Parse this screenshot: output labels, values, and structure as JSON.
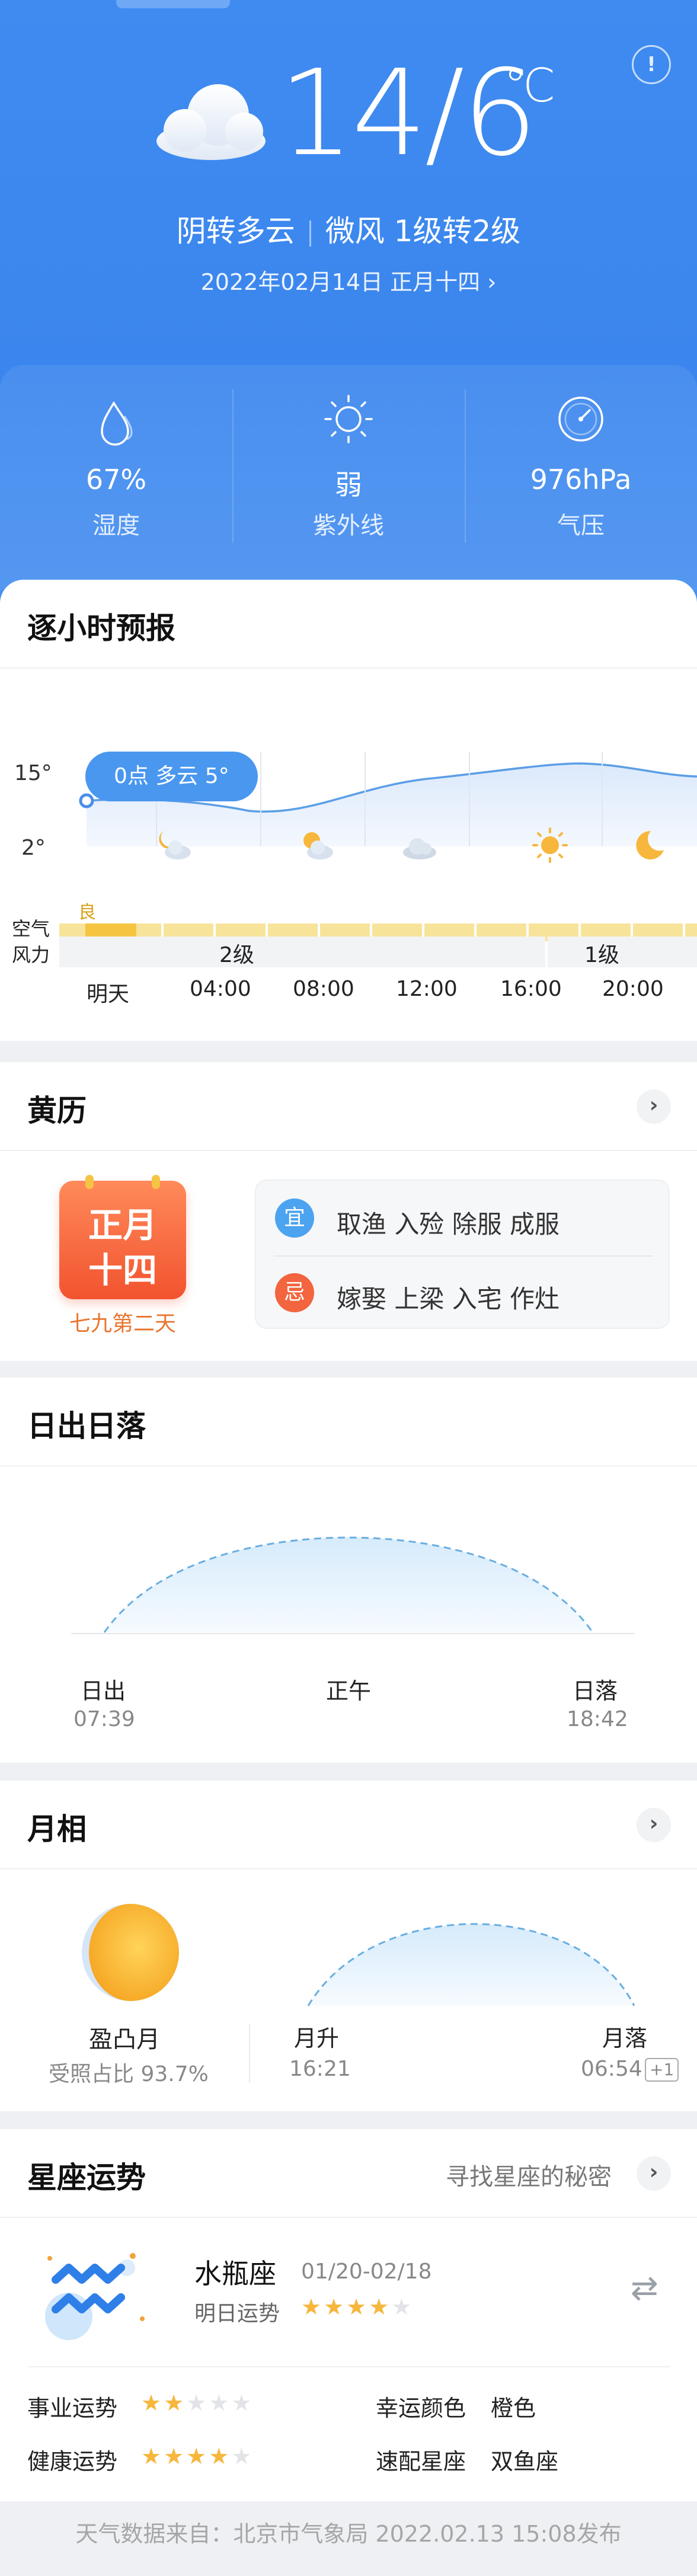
{
  "header": {
    "temperature": "14/6",
    "unit": "℃",
    "condition": "阴转多云",
    "wind": "微风 1级转2级",
    "date": "2022年02月14日 正月十四",
    "date_chevron": "›",
    "alert_symbol": "!"
  },
  "metrics": [
    {
      "icon": "humidity-drop-icon",
      "value": "67%",
      "label": "湿度"
    },
    {
      "icon": "sun-uv-icon",
      "value": "弱",
      "label": "紫外线"
    },
    {
      "icon": "pressure-gauge-icon",
      "value": "976hPa",
      "label": "气压"
    }
  ],
  "hourly": {
    "title": "逐小时预报",
    "axis_high": "15°",
    "axis_low": "2°",
    "tooltip": "0点 多云 5°",
    "air_label": "空气",
    "air_quality": "良",
    "wind_label": "风力",
    "wind_levels": [
      {
        "text": "2级"
      },
      {
        "text": "1级"
      }
    ],
    "times": [
      "明天",
      "04:00",
      "08:00",
      "12:00",
      "16:00",
      "20:00"
    ],
    "icons": [
      "cloudy-moon-icon",
      "partly-cloudy-icon",
      "cloud-icon",
      "sun-icon",
      "moon-icon"
    ],
    "colors": {
      "line": "#5b9ee6",
      "air_fill": "#f8e39a",
      "air_active": "#f5c542"
    }
  },
  "almanac": {
    "title": "黄历",
    "chevron": "›",
    "lunar_top": "正月",
    "lunar_bottom": "十四",
    "period": "七九第二天",
    "good_badge": "宜",
    "good": "取渔 入殓 除服 成服",
    "bad_badge": "忌",
    "bad": "嫁娶 上梁 入宅 作灶"
  },
  "sun": {
    "title": "日出日落",
    "sunrise_label": "日出",
    "sunrise_time": "07:39",
    "noon_label": "正午",
    "sunset_label": "日落",
    "sunset_time": "18:42"
  },
  "moon": {
    "title": "月相",
    "chevron": "›",
    "phase": "盈凸月",
    "illumination": "受照占比 93.7%",
    "moonrise_label": "月升",
    "moonrise_time": "16:21",
    "moonset_label": "月落",
    "moonset_time": "06:54",
    "next_day": "+1"
  },
  "zodiac": {
    "title": "星座运势",
    "link": "寻找星座的秘密",
    "chevron": "›",
    "name": "水瓶座",
    "range": "01/20-02/18",
    "tomorrow_label": "明日运势",
    "tomorrow_stars": 4,
    "career_label": "事业运势",
    "career_stars": 2,
    "health_label": "健康运势",
    "health_stars": 4,
    "lucky_color_label": "幸运颜色",
    "lucky_color": "橙色",
    "match_label": "速配星座",
    "match": "双鱼座",
    "swap_icon": "⇄"
  },
  "footer": {
    "source": "天气数据来自：北京市气象局 2022.02.13 15:08发布"
  }
}
